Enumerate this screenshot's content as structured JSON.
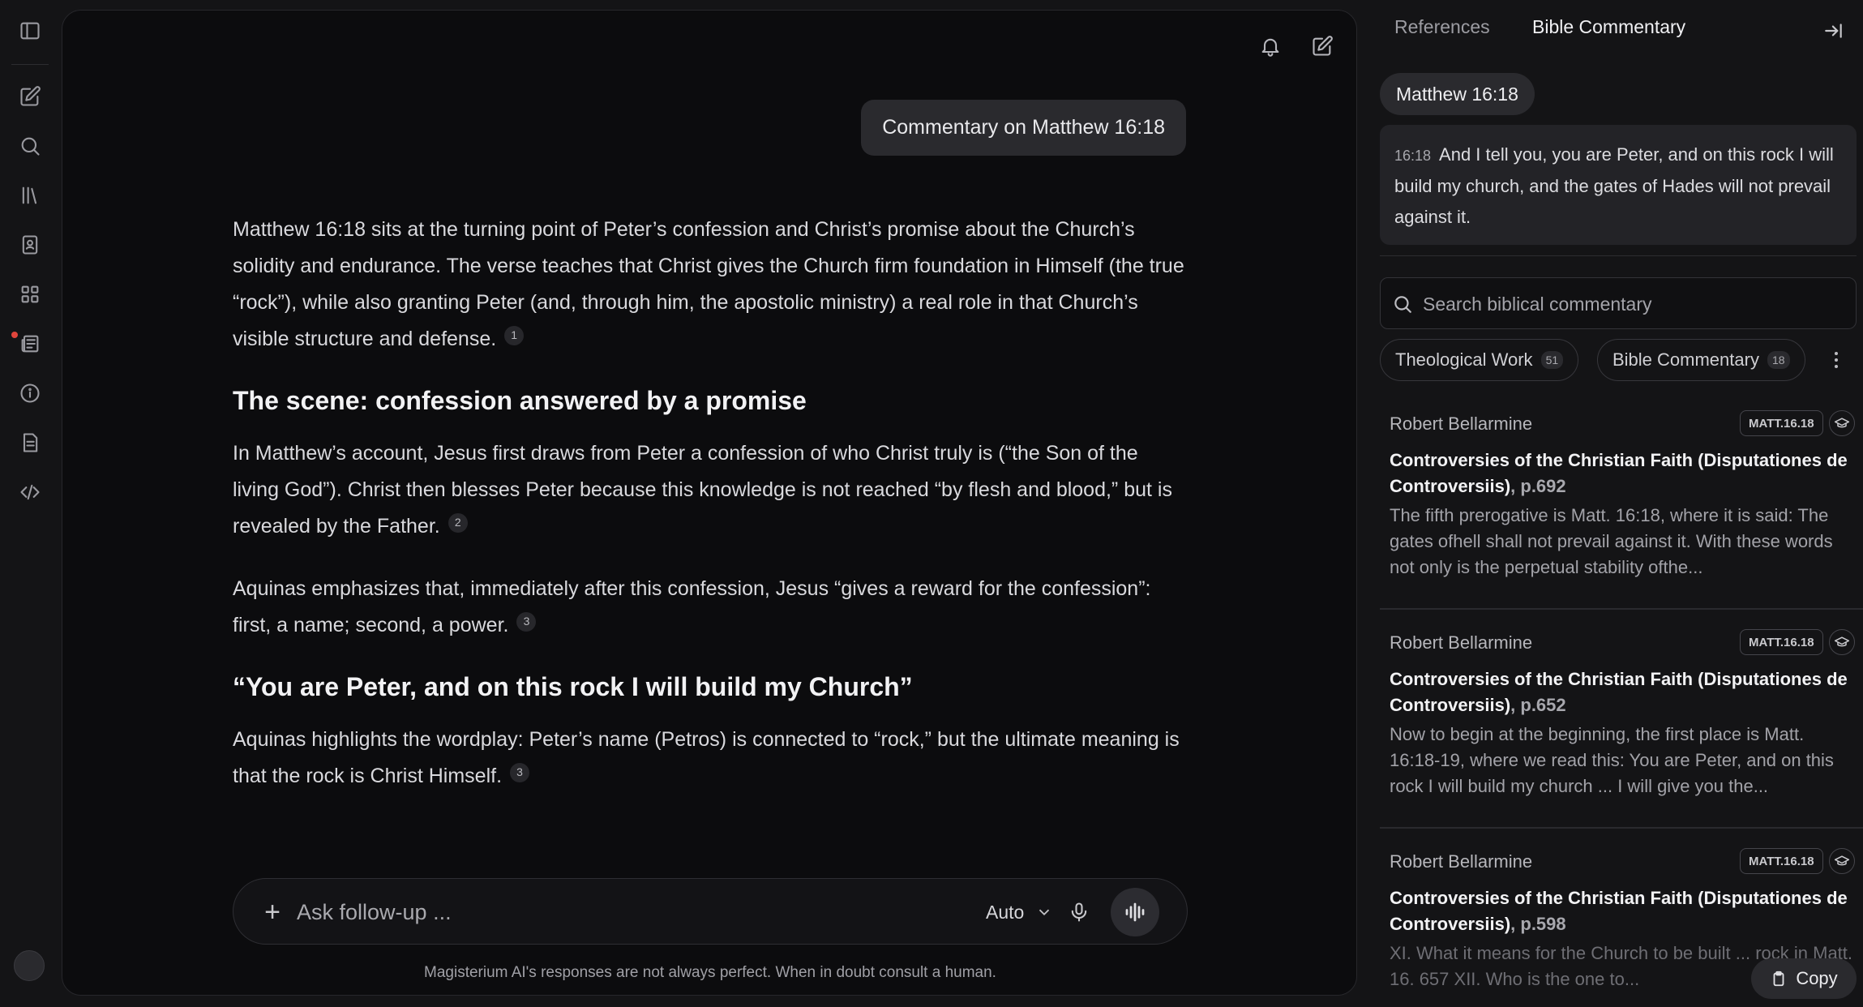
{
  "main": {
    "user_message": "Commentary on Matthew 16:18",
    "intro": "Matthew 16:18 sits at the turning point of Peter’s confession and Christ’s promise about the Church’s solidity and endurance. The verse teaches that Christ gives the Church firm foundation in Himself (the true “rock”), while also granting Peter (and, through him, the apostolic ministry) a real role in that Church’s visible structure and defense.",
    "intro_cite": "1",
    "section1_heading": "The scene: confession answered by a promise",
    "section1_p1": "In Matthew’s account, Jesus first draws from Peter a confession of who Christ truly is (“the Son of the living God”). Christ then blesses Peter because this knowledge is not reached “by flesh and blood,” but is revealed by the Father.",
    "section1_p1_cite": "2",
    "section1_p2": "Aquinas emphasizes that, immediately after this confession, Jesus “gives a reward for the confession”: first, a name; second, a power.",
    "section1_p2_cite": "3",
    "section2_heading": "“You are Peter, and on this rock I will build my Church”",
    "section2_p1": "Aquinas highlights the wordplay: Peter’s name (Petros) is connected to “rock,” but the ultimate meaning is that the rock is Christ Himself.",
    "section2_p1_cite": "3",
    "composer": {
      "placeholder": "Ask follow-up ...",
      "model": "Auto"
    },
    "disclaimer": "Magisterium AI's responses are not always perfect. When in doubt consult a human."
  },
  "right": {
    "tabs": [
      "References",
      "Bible Commentary"
    ],
    "verse_ref": "Matthew 16:18",
    "verse_num": "16:18",
    "verse_text": "And I tell you, you are Peter, and on this rock I will build my church, and the gates of Hades will not prevail against it.",
    "search_placeholder": "Search biblical commentary",
    "filters": [
      {
        "label": "Theological Work",
        "count": "51"
      },
      {
        "label": "Bible Commentary",
        "count": "18"
      }
    ],
    "cards": [
      {
        "author": "Robert Bellarmine",
        "tag": "MATT.16.18",
        "title": "Controversies of the Christian Faith (Disputationes de Controversiis)",
        "page": ", p.692",
        "excerpt": "The fifth prerogative is Matt. 16:18, where it is said: The gates ofhell shall not prevail against it. With these words not only is the perpetual stability ofthe..."
      },
      {
        "author": "Robert Bellarmine",
        "tag": "MATT.16.18",
        "title": "Controversies of the Christian Faith (Disputationes de Controversiis)",
        "page": ", p.652",
        "excerpt": "Now to begin at the beginning, the first place is Matt. 16:18-19, where we read this: You are Peter, and on this rock I will build my church ... I will give you the..."
      },
      {
        "author": "Robert Bellarmine",
        "tag": "MATT.16.18",
        "title": "Controversies of the Christian Faith (Disputationes de Controversiis)",
        "page": ", p.598",
        "excerpt": "XI. What it means for the Church to be built ... rock in Matt. 16. 657 XII. Who is the one to..."
      }
    ],
    "copy_label": "Copy"
  },
  "colors": {
    "background": "#141416",
    "panel": "#0c0c0e",
    "bubble": "#2a2a2e",
    "notification_dot": "#e0453c"
  }
}
